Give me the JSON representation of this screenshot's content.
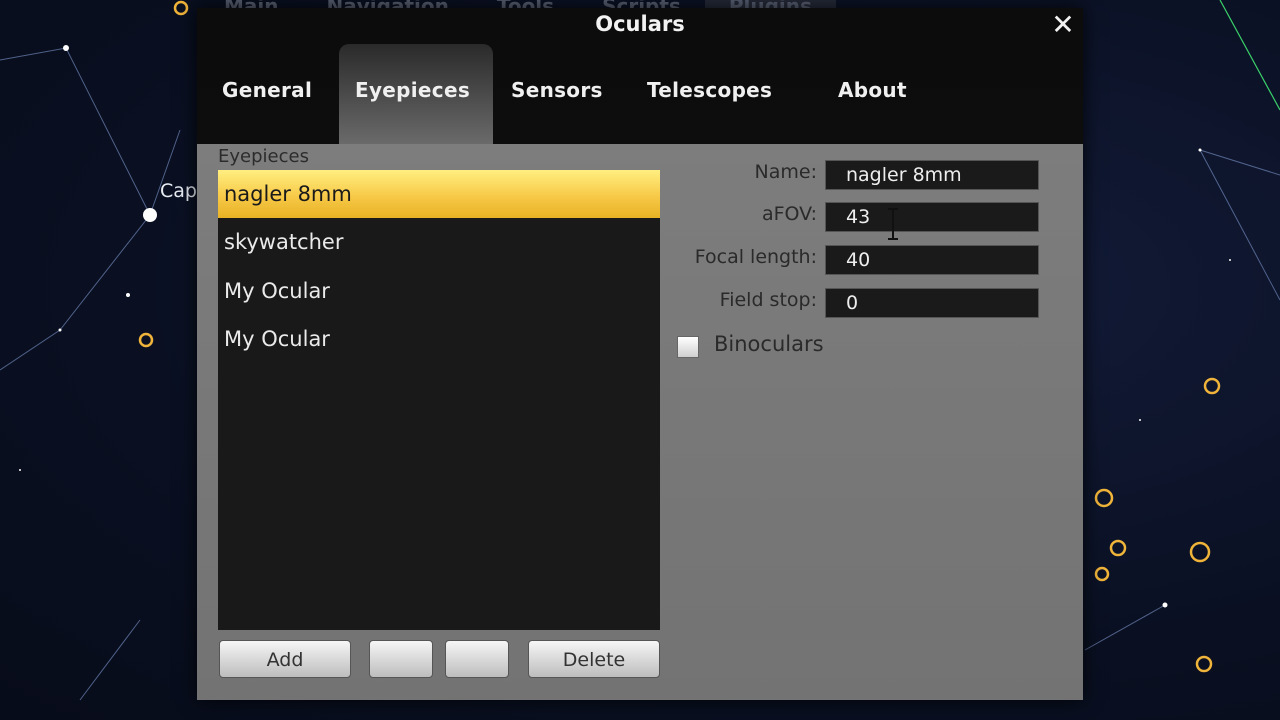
{
  "dialog": {
    "title": "Oculars",
    "close_icon": "close-icon"
  },
  "background_menu": [
    "Main",
    "Navigation",
    "Tools",
    "Scripts",
    "Plugins"
  ],
  "background_label": "Cap",
  "tabs": [
    {
      "label": "General"
    },
    {
      "label": "Eyepieces",
      "active": true
    },
    {
      "label": "Sensors"
    },
    {
      "label": "Telescopes"
    },
    {
      "label": "About"
    }
  ],
  "eyepieces": {
    "group_label": "Eyepieces",
    "items": [
      {
        "label": "nagler 8mm",
        "selected": true
      },
      {
        "label": "skywatcher"
      },
      {
        "label": "My Ocular"
      },
      {
        "label": "My Ocular"
      }
    ],
    "buttons": {
      "add": "Add",
      "up": "",
      "down": "",
      "delete": "Delete"
    }
  },
  "form": {
    "name": {
      "label": "Name:",
      "value": "nagler 8mm"
    },
    "afov": {
      "label": "aFOV:",
      "value": "43"
    },
    "focal_length": {
      "label": "Focal length:",
      "value": "40"
    },
    "field_stop": {
      "label": "Field stop:",
      "value": "0"
    },
    "binoculars": {
      "label": "Binoculars",
      "checked": false
    }
  },
  "colors": {
    "selected_row": "#f7c948",
    "panel": "#7a7a7a",
    "list_bg": "#191919"
  }
}
